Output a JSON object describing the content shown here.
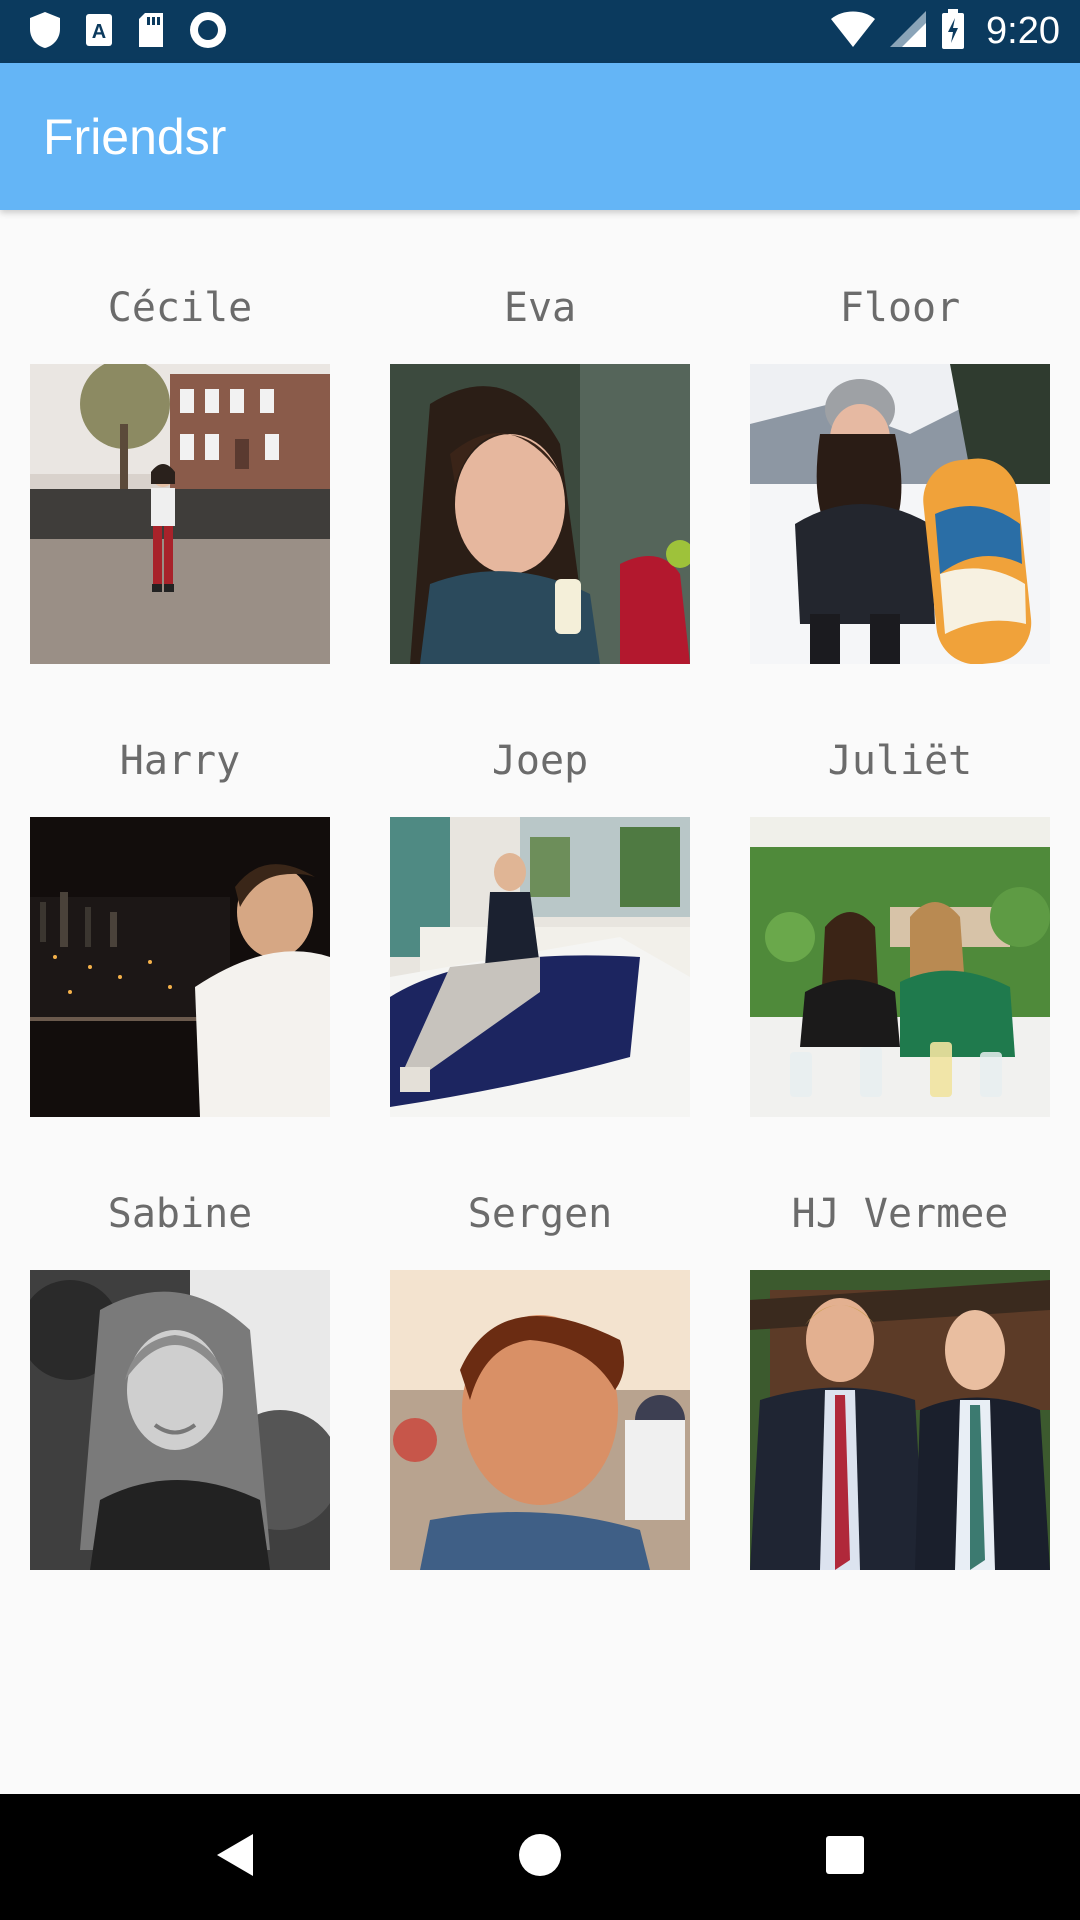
{
  "status_bar": {
    "time": "9:20",
    "icons_left": [
      "shield-icon",
      "font-a-icon",
      "sd-card-icon",
      "record-icon"
    ],
    "icons_right": [
      "wifi-icon",
      "cell-signal-icon",
      "battery-charging-icon"
    ]
  },
  "app_bar": {
    "title": "Friendsr"
  },
  "friends": [
    {
      "name": "Cécile"
    },
    {
      "name": "Eva"
    },
    {
      "name": "Floor"
    },
    {
      "name": "Harry"
    },
    {
      "name": "Joep"
    },
    {
      "name": "Juliët"
    },
    {
      "name": "Sabine"
    },
    {
      "name": "Sergen"
    },
    {
      "name": "HJ Vermee"
    }
  ],
  "nav_bar": {
    "buttons": [
      "back-icon",
      "home-icon",
      "recents-icon"
    ]
  },
  "colors": {
    "status_bar": "#0b3a5e",
    "app_bar": "#64b5f6",
    "background": "#fafafa",
    "name_text": "#6b6b6b"
  }
}
